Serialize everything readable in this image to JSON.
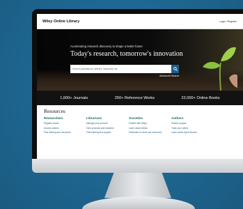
{
  "header": {
    "brand": "Wiley Online Library",
    "login": "Login / Register"
  },
  "hero": {
    "tagline": "Accelerating research discovery to shape a better future",
    "headline": "Today's research, tomorrow's innovation",
    "search_placeholder": "Search publications, articles, keywords, etc.",
    "advanced_search": "Advanced Search"
  },
  "stats": [
    "1,600+ Journals",
    "250+ Reference Works",
    "22,000+ Online Books"
  ],
  "resources": {
    "title": "Resources",
    "columns": [
      {
        "heading": "Researchers",
        "links": [
          "Register online",
          "Access options",
          "Find training and resources"
        ]
      },
      {
        "heading": "Librarians",
        "links": [
          "Manage your account",
          "View products and solutions",
          "Find training and support"
        ]
      },
      {
        "heading": "Societies",
        "links": [
          "Publish with Wiley",
          "Learn about trends",
          "Subscribe to news and resources"
        ]
      },
      {
        "heading": "Authors",
        "links": [
          "Submit a paper",
          "Track your article",
          "Learn about Open Access"
        ]
      }
    ]
  },
  "colors": {
    "background": "#1e5f86",
    "search_button": "#1d5f8c",
    "resource_heading": "#1a6d55",
    "link": "#2c5d8a"
  }
}
